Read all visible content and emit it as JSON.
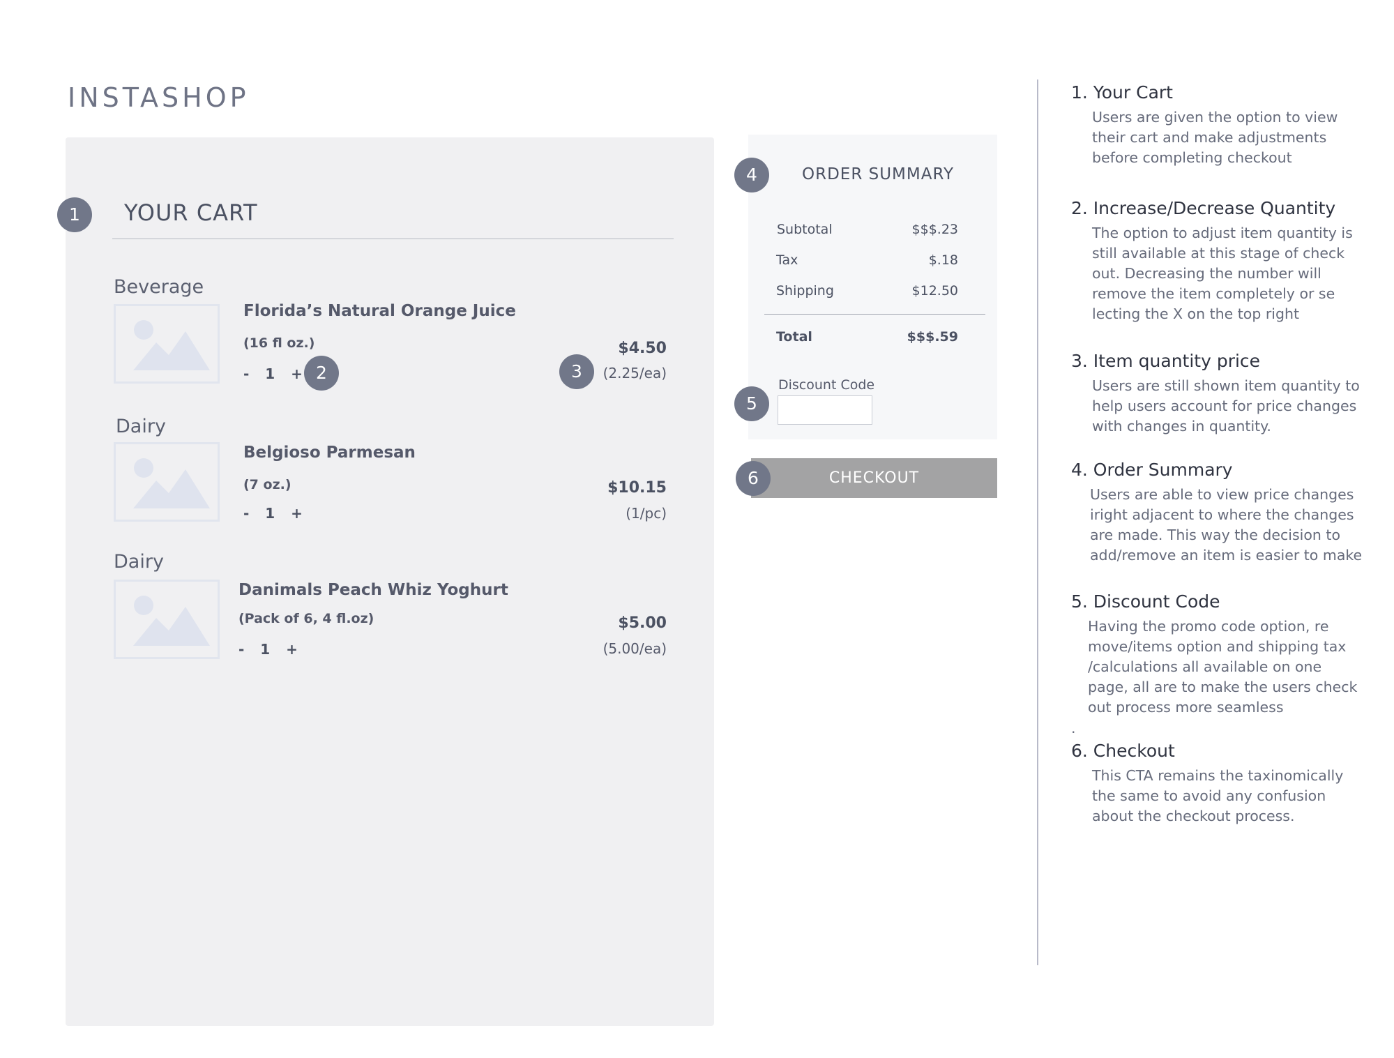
{
  "app": {
    "logo": "INSTASHOP"
  },
  "badges": [
    "1",
    "2",
    "3",
    "4",
    "5",
    "6"
  ],
  "cart": {
    "title": "YOUR CART",
    "items": [
      {
        "category": "Beverage",
        "name": "Florida’s Natural Orange Juice",
        "size": "(16 fl oz.)",
        "qty_minus": "-",
        "qty": "1",
        "qty_plus": "+",
        "price": "$4.50",
        "unit_price": "(2.25/ea)"
      },
      {
        "category": "Dairy",
        "name": "Belgioso Parmesan",
        "size": "(7 oz.)",
        "qty_minus": "-",
        "qty": "1",
        "qty_plus": "+",
        "price": "$10.15",
        "unit_price": "(1/pc)"
      },
      {
        "category": "Dairy",
        "name": "Danimals Peach Whiz Yoghurt",
        "size": "(Pack of 6, 4 fl.oz)",
        "qty_minus": "-",
        "qty": "1",
        "qty_plus": "+",
        "price": "$5.00",
        "unit_price": "(5.00/ea)"
      }
    ]
  },
  "summary": {
    "title": "ORDER SUMMARY",
    "rows": [
      {
        "label": "Subtotal",
        "value": "$$$.23"
      },
      {
        "label": "Tax",
        "value": "$.18"
      },
      {
        "label": "Shipping",
        "value": "$12.50"
      }
    ],
    "total_label": "Total",
    "total_value": "$$$.59",
    "discount_label": "Discount Code",
    "discount_value": "",
    "discount_placeholder": "",
    "checkout_label": "CHECKOUT"
  },
  "notes": [
    {
      "title": "1. Your Cart",
      "body": "Users are given the option to view\ntheir cart and make adjustments\nbefore completing checkout"
    },
    {
      "title": "2. Increase/Decrease Quantity",
      "body": "The option to adjust item quantity is\nstill available at this stage of check\nout. Decreasing the number will\nremove the item completely or se\nlecting the X on the top right"
    },
    {
      "title": "3. Item quantity price",
      "body": "Users are still shown item quantity to\nhelp users account for price changes\nwith changes in quantity."
    },
    {
      "title": "4. Order Summary",
      "body": "Users are able to view price changes\niright adjacent to where the changes\nare made. This way the decision to\nadd/remove an item is easier to make"
    },
    {
      "title": "5. Discount Code",
      "body": "Having the promo code option, re\nmove/items option and shipping tax\n/calculations all available on one\npage, all are to make the users check\nout process more seamless",
      "trailing_dot": "."
    },
    {
      "title": "6. Checkout",
      "body": "This CTA remains the taxinomically\nthe same to avoid any confusion\nabout the checkout process."
    }
  ],
  "colors": {
    "badge": "#717789",
    "cart_panel": "#f0f0f2",
    "summary_panel": "#f6f7f9",
    "checkout_button": "#a3a3a4",
    "divider": "#b8bac9"
  }
}
